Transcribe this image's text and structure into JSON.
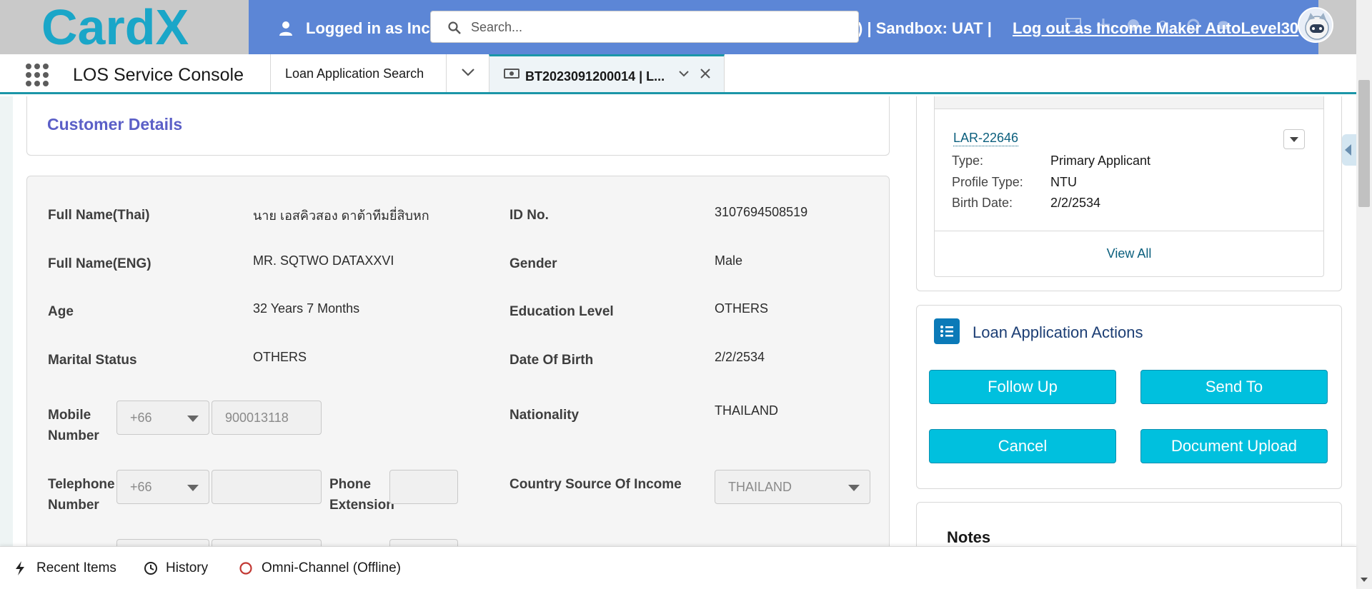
{
  "header": {
    "logo_text": "CardX",
    "banner_user_prefix": "Logged in as Inc",
    "banner_sandbox": ") | Sandbox: UAT |",
    "banner_link": "Log out as Income Maker AutoLevel30",
    "search_placeholder": "Search..."
  },
  "nav": {
    "app_name": "LOS Service Console",
    "tab_search_label": "Loan Application Search",
    "active_tab_label": "BT2023091200014 | L..."
  },
  "customer_details": {
    "section_title": "Customer Details",
    "fields": {
      "full_name_thai": {
        "label": "Full Name(Thai)",
        "value": "นาย เอสคิวสอง ดาต้าทีมยี่สิบหก"
      },
      "id_no": {
        "label": "ID No.",
        "value": "3107694508519"
      },
      "full_name_eng": {
        "label": "Full Name(ENG)",
        "value": "MR. SQTWO DATAXXVI"
      },
      "gender": {
        "label": "Gender",
        "value": "Male"
      },
      "age": {
        "label": "Age",
        "value": "32 Years 7 Months"
      },
      "education": {
        "label": "Education Level",
        "value": "OTHERS"
      },
      "marital": {
        "label": "Marital Status",
        "value": "OTHERS"
      },
      "dob": {
        "label": "Date Of Birth",
        "value": "2/2/2534"
      },
      "mobile": {
        "label_line1": "Mobile",
        "label_line2": "Number",
        "country_code": "+66",
        "number": "900013118"
      },
      "nationality": {
        "label": "Nationality",
        "value": "THAILAND"
      },
      "telephone": {
        "label_line1": "Telephone",
        "label_line2": "Number",
        "country_code": "+66",
        "number": ""
      },
      "phone_ext": {
        "label_line1": "Phone",
        "label_line2": "Extension",
        "value": ""
      },
      "country_income": {
        "label": "Country Source Of Income",
        "value": "THAILAND"
      }
    }
  },
  "related": {
    "record_link": "LAR-22646",
    "rows": [
      {
        "label": "Type:",
        "value": "Primary Applicant"
      },
      {
        "label": "Profile Type:",
        "value": "NTU"
      },
      {
        "label": "Birth Date:",
        "value": "2/2/2534"
      }
    ],
    "view_all": "View All"
  },
  "actions": {
    "title": "Loan Application Actions",
    "follow_up": "Follow Up",
    "send_to": "Send To",
    "cancel": "Cancel",
    "document_upload": "Document Upload"
  },
  "notes": {
    "title": "Notes"
  },
  "utility_bar": {
    "recent_items": "Recent Items",
    "history": "History",
    "omni_channel": "Omni-Channel (Offline)"
  },
  "colors": {
    "banner": "#5c86d6",
    "accent_teal": "#1b96a8",
    "action_button": "#00c0de",
    "section_title": "#5b5fc7",
    "logo": "#1aa6c8"
  }
}
